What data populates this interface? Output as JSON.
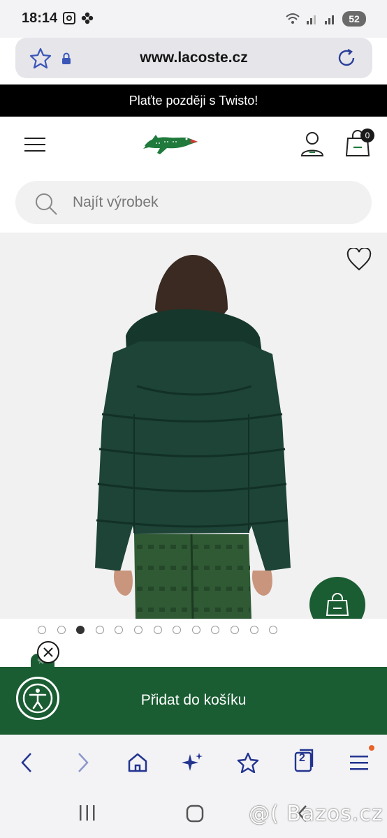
{
  "status_bar": {
    "time": "18:14",
    "battery": "52"
  },
  "url_bar": {
    "url": "www.lacoste.cz"
  },
  "promo": {
    "text": "Plaťte později s Twisto!"
  },
  "header": {
    "cart_count": "0"
  },
  "search": {
    "placeholder": "Najít výrobek"
  },
  "product": {
    "image_count": 13,
    "active_image_index": 2
  },
  "badge": {
    "text": "%"
  },
  "add_to_cart": {
    "label": "Přidat do košíku"
  },
  "browser_nav": {
    "tabs_count": "2"
  },
  "watermark": {
    "text": "@( Bazos.cz"
  },
  "colors": {
    "brand_green": "#1a5d32",
    "promo_bg": "#000000",
    "nav_accent": "#23348f",
    "notification": "#e8622a"
  },
  "icons": {
    "menu": "hamburger-icon",
    "logo": "crocodile-logo",
    "account": "user-icon",
    "bag": "shopping-bag-icon",
    "search": "magnifier-icon",
    "wishlist": "heart-icon",
    "accessibility": "accessibility-person-icon"
  }
}
